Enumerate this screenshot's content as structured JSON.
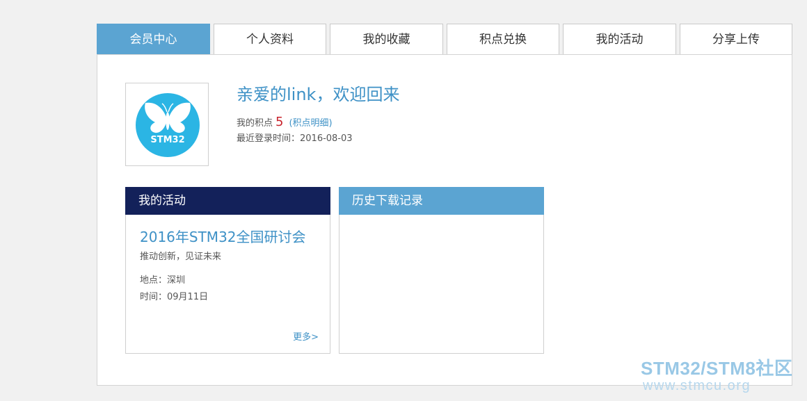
{
  "tabs": [
    {
      "label": "会员中心",
      "active": true
    },
    {
      "label": "个人资料",
      "active": false
    },
    {
      "label": "我的收藏",
      "active": false
    },
    {
      "label": "积点兑换",
      "active": false
    },
    {
      "label": "我的活动",
      "active": false
    },
    {
      "label": "分享上传",
      "active": false
    }
  ],
  "profile": {
    "avatar_icon": "butterfly-icon",
    "avatar_text": "STM32",
    "welcome": "亲爱的link，欢迎回来",
    "points_label": "我的积点",
    "points_value": "5",
    "points_link": "(积点明细)",
    "last_login": "最近登录时间：2016-08-03"
  },
  "activity_card": {
    "header": "我的活动",
    "event_title": "2016年STM32全国研讨会",
    "event_subtitle": "推动创新，见证未来",
    "location": "地点：深圳",
    "time": "时间：09月11日",
    "more": "更多>"
  },
  "history_card": {
    "header": "历史下载记录"
  },
  "watermark": {
    "title": "STM32/STM8社区",
    "url": "www.stmcu.org"
  },
  "colors": {
    "accent": "#5ba4d2",
    "navy": "#13215a",
    "link": "#3e91c6",
    "points": "#c8232c",
    "avatar_bg": "#2bb5e4"
  }
}
